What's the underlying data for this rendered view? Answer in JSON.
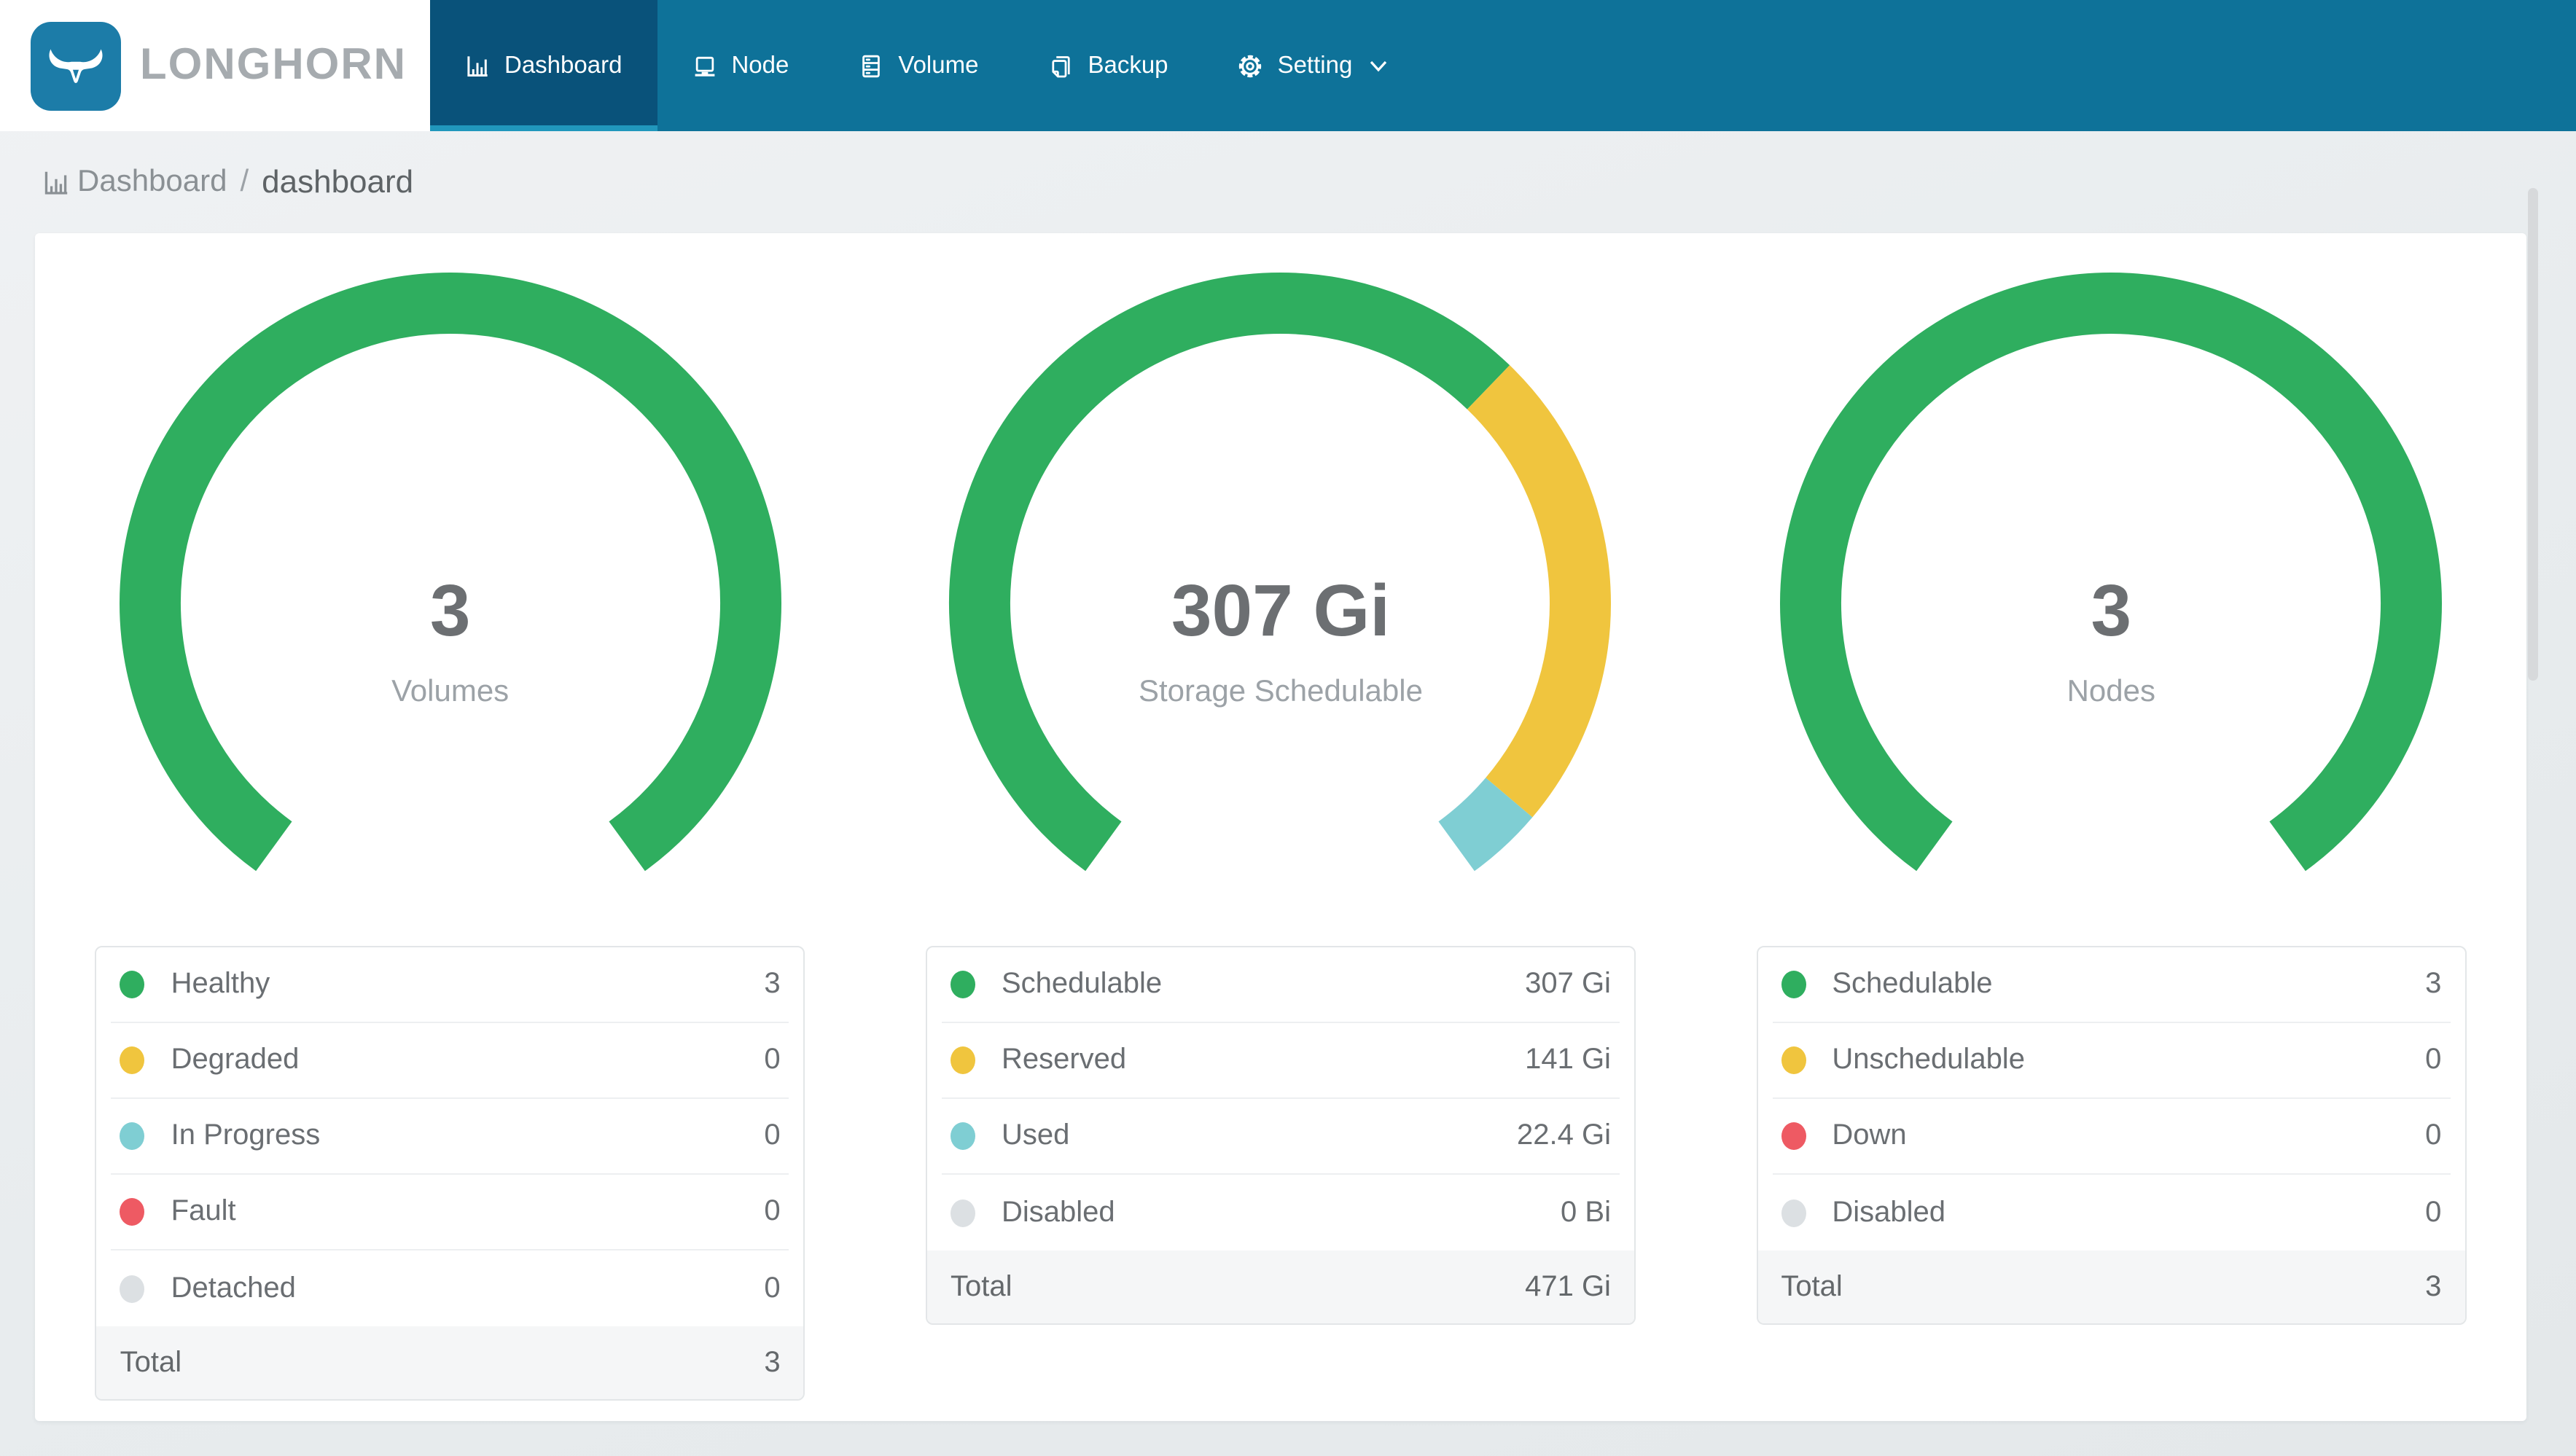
{
  "nav": {
    "brand": "LONGHORN",
    "items": [
      {
        "label": "Dashboard",
        "icon": "bar-chart-icon",
        "active": true
      },
      {
        "label": "Node",
        "icon": "node-icon",
        "active": false
      },
      {
        "label": "Volume",
        "icon": "database-icon",
        "active": false
      },
      {
        "label": "Backup",
        "icon": "copy-icon",
        "active": false
      },
      {
        "label": "Setting",
        "icon": "gear-icon",
        "active": false,
        "has_caret": true
      }
    ]
  },
  "breadcrumb": {
    "root": "Dashboard",
    "separator": "/",
    "current": "dashboard"
  },
  "colors": {
    "navbar": "#0E7299",
    "navbar_active": "#09527A",
    "active_underline": "#2197BC",
    "logo_tile": "#1C7CA8",
    "brand_text": "#A6ABAF",
    "page_background": "#E9EDEF",
    "card_background": "#FFFFFF",
    "total_row_background": "#F5F6F7",
    "text_primary": "#6B6F73",
    "text_muted": "#9CA2A7",
    "green": "#2FAE5F",
    "yellow": "#F0C53E",
    "teal": "#7FCED3",
    "red": "#EE5A63",
    "gray": "#DCE0E3"
  },
  "chart_data": [
    {
      "id": "volumes",
      "type": "gauge-donut",
      "arc_degrees": 288,
      "gap_position": "bottom",
      "center_value": "3",
      "center_label": "Volumes",
      "segments": [
        {
          "label": "Healthy",
          "value": 3,
          "display": "3",
          "color": "#2FAE5F"
        },
        {
          "label": "Degraded",
          "value": 0,
          "display": "0",
          "color": "#F0C53E"
        },
        {
          "label": "In Progress",
          "value": 0,
          "display": "0",
          "color": "#7FCED3"
        },
        {
          "label": "Fault",
          "value": 0,
          "display": "0",
          "color": "#EE5A63"
        },
        {
          "label": "Detached",
          "value": 0,
          "display": "0",
          "color": "#DCE0E3"
        }
      ],
      "total": {
        "label": "Total",
        "value": 3,
        "display": "3"
      }
    },
    {
      "id": "storage",
      "type": "gauge-donut",
      "arc_degrees": 288,
      "gap_position": "bottom",
      "center_value": "307 Gi",
      "center_label": "Storage Schedulable",
      "segments": [
        {
          "label": "Schedulable",
          "value": 307,
          "display": "307 Gi",
          "color": "#2FAE5F"
        },
        {
          "label": "Reserved",
          "value": 141,
          "display": "141 Gi",
          "color": "#F0C53E"
        },
        {
          "label": "Used",
          "value": 22.4,
          "display": "22.4 Gi",
          "color": "#7FCED3"
        },
        {
          "label": "Disabled",
          "value": 0,
          "display": "0 Bi",
          "color": "#DCE0E3"
        }
      ],
      "total": {
        "label": "Total",
        "value": 471,
        "display": "471 Gi"
      }
    },
    {
      "id": "nodes",
      "type": "gauge-donut",
      "arc_degrees": 288,
      "gap_position": "bottom",
      "center_value": "3",
      "center_label": "Nodes",
      "segments": [
        {
          "label": "Schedulable",
          "value": 3,
          "display": "3",
          "color": "#2FAE5F"
        },
        {
          "label": "Unschedulable",
          "value": 0,
          "display": "0",
          "color": "#F0C53E"
        },
        {
          "label": "Down",
          "value": 0,
          "display": "0",
          "color": "#EE5A63"
        },
        {
          "label": "Disabled",
          "value": 0,
          "display": "0",
          "color": "#DCE0E3"
        }
      ],
      "total": {
        "label": "Total",
        "value": 3,
        "display": "3"
      }
    }
  ]
}
